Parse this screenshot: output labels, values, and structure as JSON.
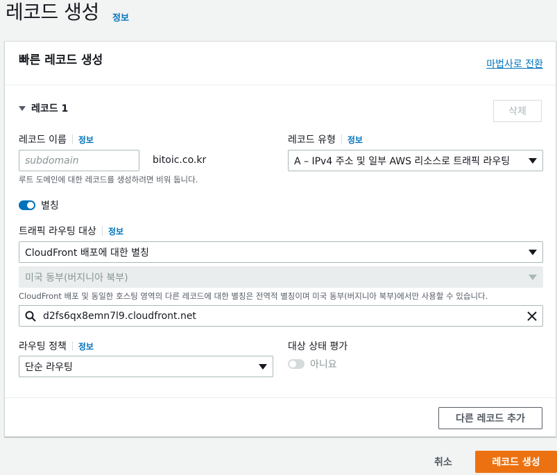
{
  "page": {
    "title": "레코드 생성",
    "info": "정보"
  },
  "panel": {
    "title": "빠른 레코드 생성",
    "wizard_link": "마법사로 전환"
  },
  "record": {
    "heading": "레코드 1",
    "delete_label": "삭제",
    "name_label": "레코드 이름",
    "name_info": "정보",
    "name_placeholder": "subdomain",
    "domain_suffix": "bitoic.co.kr",
    "name_help": "루트 도메인에 대한 레코드를 생성하려면 비워 둡니다.",
    "type_label": "레코드 유형",
    "type_info": "정보",
    "type_value": "A – IPv4 주소 및 일부 AWS 리소스로 트래픽 라우팅",
    "alias_label": "별칭",
    "alias_on": true,
    "target_label": "트래픽 라우팅 대상",
    "target_info": "정보",
    "target_value": "CloudFront 배포에 대한 별칭",
    "region_value": "미국 동부(버지니아 북부)",
    "target_help": "CloudFront 배포 및 동일한 호스팅 영역의 다른 레코드에 대한 별칭은 전역적 별칭이며 미국 동부(버지니아 북부)에서만 사용할 수 있습니다.",
    "endpoint_value": "d2fs6qx8emn7l9.cloudfront.net",
    "policy_label": "라우팅 정책",
    "policy_info": "정보",
    "policy_value": "단순 라우팅",
    "health_label": "대상 상태 평가",
    "health_value": "아니요",
    "health_on": false
  },
  "footer": {
    "add_record_label": "다른 레코드 추가",
    "cancel_label": "취소",
    "create_label": "레코드 생성"
  },
  "icons": {
    "search": "search-icon",
    "clear": "close-icon",
    "caret": "caret-down-icon"
  },
  "colors": {
    "primary": "#ec7211",
    "link": "#0073bb",
    "toggle_on": "#0073bb"
  }
}
